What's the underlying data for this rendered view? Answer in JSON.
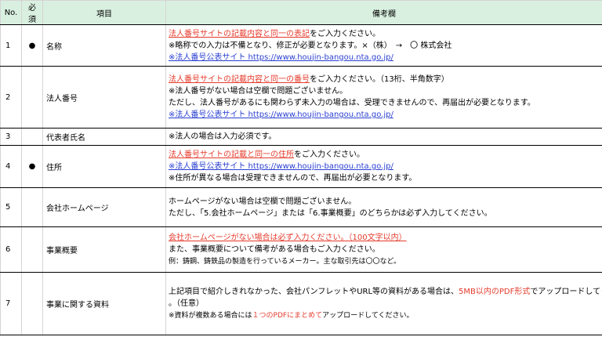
{
  "headers": {
    "no": "No.",
    "required": "必須",
    "item": "項目",
    "note": "備考欄"
  },
  "rows": [
    {
      "no": "1",
      "required": "●",
      "item": "名称",
      "lines": [
        [
          {
            "t": "法人番号サイトの記載内容と同一の表記",
            "s": "red u"
          },
          {
            "t": "をご入力ください。"
          }
        ],
        [
          {
            "t": "※略称での入力は不備となり、修正が必要となります。×（株）　→　〇 株式会社"
          }
        ],
        [
          {
            "t": "※法人番号公表サイト  https://www.houjin-bangou.nta.go.jp/",
            "s": "link"
          }
        ]
      ]
    },
    {
      "no": "2",
      "required": "",
      "item": "法人番号",
      "lines": [
        [
          {
            "t": "法人番号サイトの記載内容と同一の番号",
            "s": "red u"
          },
          {
            "t": "をご入力ください。（13桁、半角数字）"
          }
        ],
        [
          {
            "t": "※法人番号がない場合は空欄で問題ございません。"
          }
        ],
        [
          {
            "t": "ただし、法人番号があるにも関わらず未入力の場合は、受理できませんので、再届出が必要となります。"
          }
        ],
        [
          {
            "t": "※法人番号公表サイト  https://www.houjin-bangou.nta.go.jp/",
            "s": "link"
          }
        ]
      ]
    },
    {
      "no": "3",
      "required": "",
      "item": "代表者氏名",
      "lines": [
        [
          {
            "t": "※法人の場合は入力必須です。"
          }
        ]
      ]
    },
    {
      "no": "4",
      "required": "●",
      "item": "住所",
      "lines": [
        [
          {
            "t": "法人番号サイトの記載と同一の住所",
            "s": "red u"
          },
          {
            "t": "をご入力ください。"
          }
        ],
        [
          {
            "t": "※法人番号公表サイト  https://www.houjin-bangou.nta.go.jp/",
            "s": "link"
          }
        ],
        [
          {
            "t": "※住所が異なる場合は受理できませんので、再届出が必要となります。"
          }
        ]
      ]
    },
    {
      "no": "5",
      "required": "",
      "item": "会社ホームページ",
      "lines": [
        [
          {
            "t": "ホームページがない場合は空欄で問題ございません。"
          }
        ],
        [
          {
            "t": "ただし、「5.会社ホームページ」または「6.事業概要」のどちらかは必ず入力してください。"
          }
        ]
      ]
    },
    {
      "no": "6",
      "required": "",
      "item": "事業概要",
      "lines": [
        [
          {
            "t": "会社ホームページがない場合は必ず入力ください。（100文字以内）",
            "s": "red u"
          }
        ],
        [
          {
            "t": "また、事業概要について備考がある場合もご入力ください。"
          }
        ],
        [
          {
            "t": "例：鋳鋼、鋳鉄品の製造を行っているメーカー。主な取引先は〇〇など。",
            "s": "small"
          }
        ]
      ]
    },
    {
      "no": "7",
      "required": "",
      "item": "事業に関する資料",
      "lines": [
        [
          {
            "t": "上記項目で紹介しきれなかった、会社パンフレットやURL等の資料がある場合は、"
          },
          {
            "t": "5MB以内のPDF形式",
            "s": "red"
          },
          {
            "t": "でアップロードしてください"
          }
        ],
        [
          {
            "t": "。（任意）"
          }
        ],
        [
          {
            "t": "※資料が複数ある場合には",
            "s": "small"
          },
          {
            "t": "１つのPDFにまとめて",
            "s": "red small"
          },
          {
            "t": "アップロードしてください。",
            "s": "small"
          }
        ]
      ]
    }
  ]
}
